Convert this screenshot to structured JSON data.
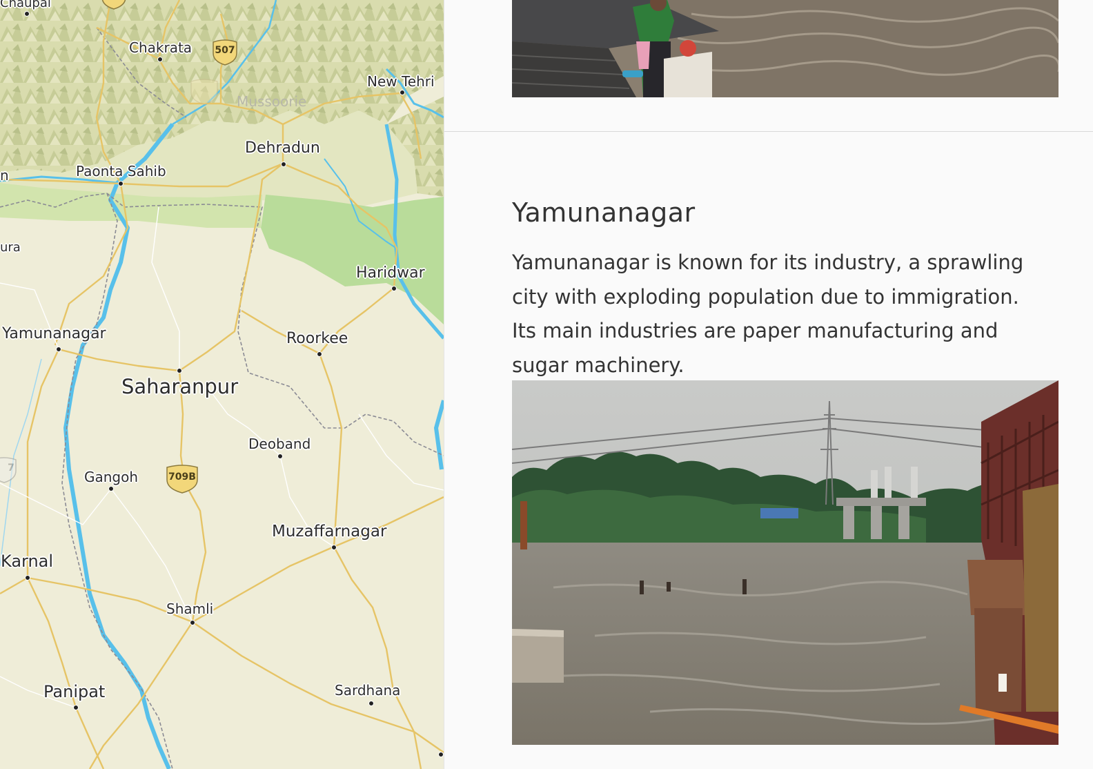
{
  "map": {
    "places": [
      {
        "id": "chaupal",
        "label": "Chaupal"
      },
      {
        "id": "chakrata",
        "label": "Chakrata"
      },
      {
        "id": "new-tehri",
        "label": "New Tehri"
      },
      {
        "id": "mussoorie",
        "label": "Mussoorie"
      },
      {
        "id": "dehradun",
        "label": "Dehradun"
      },
      {
        "id": "paonta-sahib",
        "label": "Paonta Sahib"
      },
      {
        "id": "edge-left-1",
        "label": "n"
      },
      {
        "id": "edge-left-2",
        "label": "ura"
      },
      {
        "id": "haridwar",
        "label": "Haridwar"
      },
      {
        "id": "yamunanagar",
        "label": "Yamunanagar"
      },
      {
        "id": "roorkee",
        "label": "Roorkee"
      },
      {
        "id": "saharanpur",
        "label": "Saharanpur"
      },
      {
        "id": "deoband",
        "label": "Deoband"
      },
      {
        "id": "gangoh",
        "label": "Gangoh"
      },
      {
        "id": "muzaffarnagar",
        "label": "Muzaffarnagar"
      },
      {
        "id": "karnal",
        "label": "Karnal"
      },
      {
        "id": "shamli",
        "label": "Shamli"
      },
      {
        "id": "panipat",
        "label": "Panipat"
      },
      {
        "id": "sardhana",
        "label": "Sardhana"
      }
    ],
    "shields": [
      {
        "id": "507",
        "label": "507"
      },
      {
        "id": "709b",
        "label": "709B"
      },
      {
        "id": "edge",
        "label": "7"
      }
    ],
    "colors": {
      "land": "#eeecd6",
      "forest": "#b9dc9a",
      "river": "#58c0ea",
      "road": "#e8c468",
      "border": "#8a8a94",
      "shield": "#f2d77a"
    }
  },
  "section": {
    "title": "Yamunanagar",
    "body": "Yamunanagar is known for its industry, a sprawling city with exploding population due to immigration. Its main industries are paper manufacturing and sugar machinery."
  }
}
